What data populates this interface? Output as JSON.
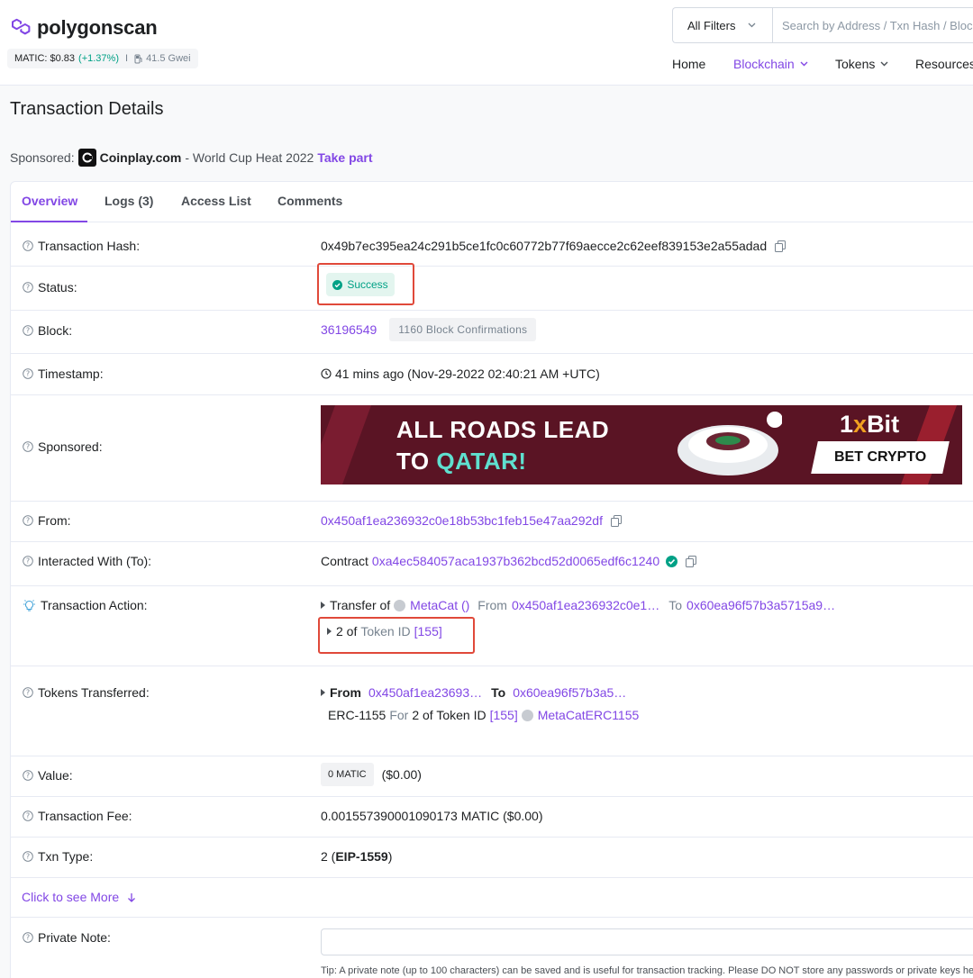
{
  "header": {
    "logo_text": "polygonscan",
    "price_label": "MATIC: $0.83",
    "price_change": "(+1.37%)",
    "price_sep": "I",
    "gas": "41.5 Gwei",
    "filter_label": "All Filters",
    "search_placeholder": "Search by Address / Txn Hash / Block",
    "nav": [
      {
        "label": "Home"
      },
      {
        "label": "Blockchain"
      },
      {
        "label": "Tokens"
      },
      {
        "label": "Resources"
      }
    ]
  },
  "page": {
    "title": "Transaction Details",
    "sponsored_prefix": "Sponsored:",
    "sponsor_brand": "Coinplay.com",
    "sponsor_text": "- World Cup Heat 2022",
    "sponsor_cta": "Take part"
  },
  "tabs": [
    {
      "label": "Overview"
    },
    {
      "label": "Logs (3)"
    },
    {
      "label": "Access List"
    },
    {
      "label": "Comments"
    }
  ],
  "details": {
    "tx_hash_label": "Transaction Hash:",
    "tx_hash": "0x49b7ec395ea24c291b5ce1fc0c60772b77f69aecce2c62eef839153e2a55adad",
    "status_label": "Status:",
    "status": "Success",
    "block_label": "Block:",
    "block": "36196549",
    "confirmations": "1160 Block Confirmations",
    "timestamp_label": "Timestamp:",
    "timestamp": "41 mins ago (Nov-29-2022 02:40:21 AM +UTC)",
    "sponsored_label": "Sponsored:",
    "banner_line1": "ALL ROADS LEAD",
    "banner_line2_a": "TO ",
    "banner_line2_b": "QATAR!",
    "banner_brand_a": "1",
    "banner_brand_x": "x",
    "banner_brand_b": "Bit",
    "banner_cta": "BET CRYPTO",
    "from_label": "From:",
    "from": "0x450af1ea236932c0e18b53bc1feb15e47aa292df",
    "to_label": "Interacted With (To):",
    "to_prefix": "Contract",
    "to": "0xa4ec584057aca1937b362bcd52d0065edf6c1240",
    "action_label": "Transaction Action:",
    "action_transfer": "Transfer of",
    "action_token": "MetaCat ()",
    "action_from_label": "From",
    "action_from": "0x450af1ea236932c0e1…",
    "action_to_label": "To",
    "action_to": "0x60ea96f57b3a5715a9…",
    "action_qty": "2 of",
    "action_token_id_label": "Token ID",
    "action_token_id": "[155]",
    "tokens_label": "Tokens Transferred:",
    "tokens_from_label": "From",
    "tokens_from": "0x450af1ea23693…",
    "tokens_to_label": "To",
    "tokens_to": "0x60ea96f57b3a5…",
    "tokens_standard": "ERC-1155",
    "tokens_for": "For",
    "tokens_qty": "2 of Token ID",
    "tokens_id": "[155]",
    "tokens_name": "MetaCatERC1155",
    "value_label": "Value:",
    "value_badge": "0 MATIC",
    "value_usd": "($0.00)",
    "fee_label": "Transaction Fee:",
    "fee": "0.001557390001090173 MATIC ($0.00)",
    "txn_type_label": "Txn Type:",
    "txn_type_num": "2 (",
    "txn_type_name": "EIP-1559",
    "txn_type_close": ")",
    "click_more": "Click to see More",
    "private_note_label": "Private Note:",
    "tip": "Tip: A private note (up to 100 characters) can be saved and is useful for transaction tracking. Please DO NOT store any passwords or private keys here."
  },
  "colors": {
    "accent": "#8247e5",
    "success": "#00a186",
    "highlight": "#e0493a"
  }
}
